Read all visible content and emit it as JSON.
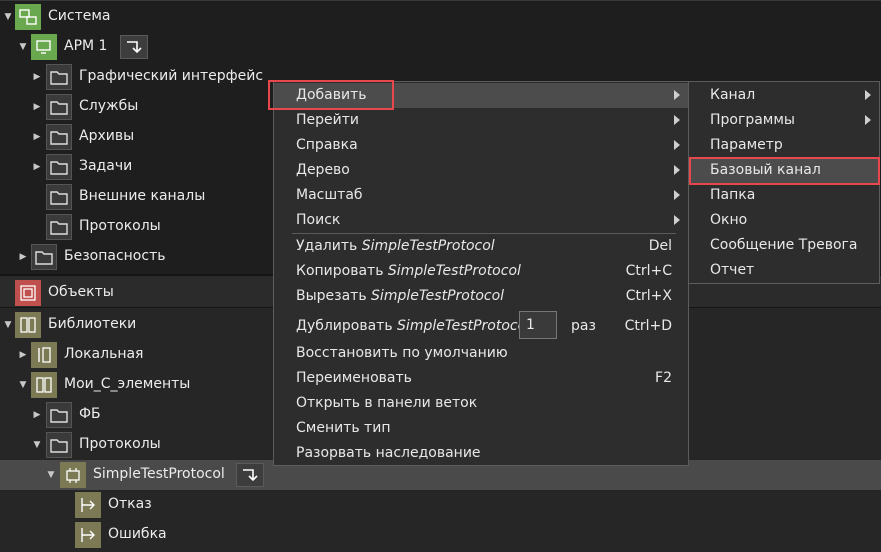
{
  "tree": {
    "system": "Система",
    "arm": "АРМ 1",
    "gui": "Графический интерфейс",
    "services": "Службы",
    "archives": "Архивы",
    "tasks": "Задачи",
    "ext_channels": "Внешние каналы",
    "protocols1": "Протоколы",
    "security": "Безопасность",
    "objects": "Объекты",
    "libraries": "Библиотеки",
    "local": "Локальная",
    "my_elements": "Мои_С_элементы",
    "fb": "ФБ",
    "protocols2": "Протоколы",
    "simple": "SimpleTestProtocol",
    "fail": "Отказ",
    "error": "Ошибка"
  },
  "context_menu": {
    "add": "Добавить",
    "goto": "Перейти",
    "help": "Справка",
    "tree": "Дерево",
    "scale": "Масштаб",
    "search": "Поиск",
    "delete_prefix": "Удалить ",
    "delete_target": "SimpleTestProtocol",
    "delete_key": "Del",
    "copy_prefix": "Копировать ",
    "copy_target": "SimpleTestProtocol",
    "copy_key": "Ctrl+C",
    "cut_prefix": "Вырезать ",
    "cut_target": "SimpleTestProtocol",
    "cut_key": "Ctrl+X",
    "dup_prefix": "Дублировать ",
    "dup_target": "SimpleTestProtocol",
    "dup_count": "1",
    "dup_unit": "раз",
    "dup_key": "Ctrl+D",
    "restore": "Восстановить по умолчанию",
    "rename": "Переименовать",
    "rename_key": "F2",
    "open_branch": "Открыть в панели веток",
    "change_type": "Сменить тип",
    "break_inherit": "Разорвать наследование"
  },
  "submenu": {
    "channel": "Канал",
    "programs": "Программы",
    "param": "Параметр",
    "base_channel": "Базовый канал",
    "folder": "Папка",
    "window": "Окно",
    "alarm": "Сообщение Тревога",
    "report": "Отчет"
  },
  "colors": {
    "highlight_box": "#e8474e",
    "node_green": "#6aa84f",
    "node_olive": "#7b7a55",
    "objects_red": "#c0504d"
  }
}
